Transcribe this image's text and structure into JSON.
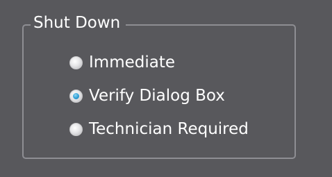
{
  "shutdown": {
    "title": "Shut Down",
    "options": [
      {
        "label": "Immediate",
        "checked": false
      },
      {
        "label": "Verify Dialog Box",
        "checked": true
      },
      {
        "label": "Technician Required",
        "checked": false
      }
    ],
    "colors": {
      "background": "#58585c",
      "border": "#8e8e93",
      "accent": "#2f9fd6",
      "text": "#ffffff"
    }
  }
}
